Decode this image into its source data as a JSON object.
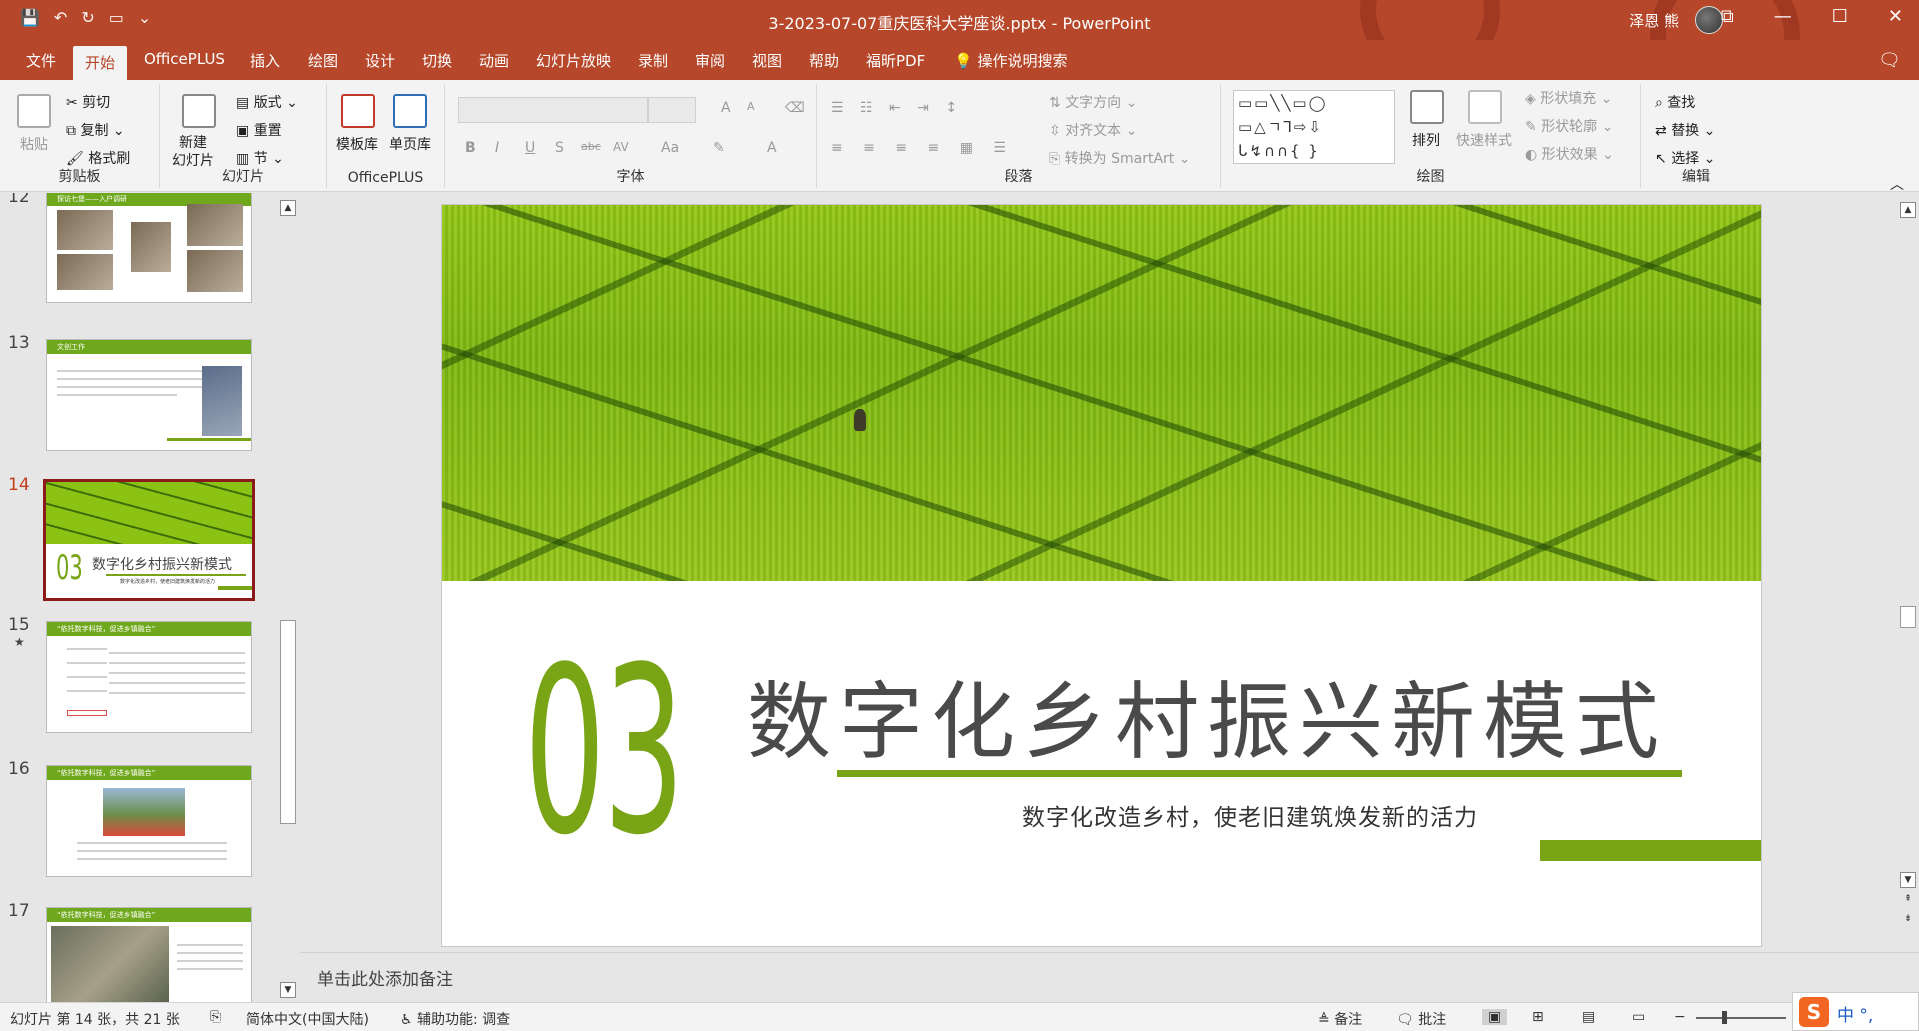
{
  "window": {
    "title": "3-2023-07-07重庆医科大学座谈.pptx  -  PowerPoint",
    "user": "泽恩 熊",
    "controls": [
      "⧉",
      "—",
      "☐",
      "✕"
    ]
  },
  "qat": {
    "save": "💾",
    "undo": "↶",
    "redo": "↻",
    "present": "▭",
    "more": "⌄"
  },
  "tabs": [
    "文件",
    "开始",
    "OfficePLUS",
    "插入",
    "绘图",
    "设计",
    "切换",
    "动画",
    "幻灯片放映",
    "录制",
    "审阅",
    "视图",
    "帮助",
    "福昕PDF"
  ],
  "tellme": "操作说明搜索",
  "ribbon": {
    "clipboard": {
      "label": "剪贴板",
      "paste": "粘贴",
      "cut": "剪切",
      "copy": "复制",
      "format_painter": "格式刷"
    },
    "slides": {
      "label": "幻灯片",
      "new_slide": "新建\n幻灯片",
      "layout": "版式",
      "reset": "重置",
      "section": "节"
    },
    "officeplus": {
      "label": "OfficePLUS",
      "template_lib": "模板库",
      "page_lib": "单页库"
    },
    "font": {
      "label": "字体",
      "bold": "B",
      "italic": "I",
      "underline": "U",
      "shadow": "S",
      "strike": "abc",
      "spacing": "AV",
      "case": "Aa",
      "grow": "A",
      "shrink": "A"
    },
    "paragraph": {
      "label": "段落",
      "text_direction": "文字方向",
      "align_text": "对齐文本",
      "smartart": "转换为 SmartArt"
    },
    "drawing": {
      "label": "绘图",
      "arrange": "排列",
      "quick_styles": "快速样式",
      "shape_fill": "形状填充",
      "shape_outline": "形状轮廓",
      "shape_effects": "形状效果",
      "shapes_glyphs": "▭▭╲╲▭◯\n▭△ㄱ⅂⇨⇩\nᒐ↯∩∩{ }"
    },
    "editing": {
      "label": "编辑",
      "find": "查找",
      "replace": "替换",
      "select": "选择"
    }
  },
  "thumbnails": [
    {
      "num": "12",
      "title": "探访七堡——入户调研"
    },
    {
      "num": "13",
      "title": "文创工作"
    },
    {
      "num": "14",
      "title": "数字化乡村振兴新模式",
      "big": "03",
      "sub": "数字化改造乡村，使老旧建筑焕发新的活力"
    },
    {
      "num": "15",
      "star": "★",
      "title": "“依托数字科技，促进乡镇融合”"
    },
    {
      "num": "16",
      "title": "“依托数字科技，促进乡镇融合”"
    },
    {
      "num": "17",
      "title": "“依托数字科技，促进乡镇融合”"
    }
  ],
  "slide": {
    "number": "03",
    "title": "数字化乡村振兴新模式",
    "subtitle": "数字化改造乡村，使老旧建筑焕发新的活力",
    "accent": "#78a416"
  },
  "notes_placeholder": "单击此处添加备注",
  "status": {
    "slide_info": "幻灯片 第 14 张，共 21 张",
    "language": "简体中文(中国大陆)",
    "accessibility": "辅助功能: 调查",
    "notes": "备注",
    "comments": "批注"
  },
  "ime": {
    "logo": "S",
    "text": "中 °,"
  },
  "colors": {
    "brand": "#b7472a",
    "accent": "#78a416",
    "selected_thumb": "#8b1a1a"
  }
}
